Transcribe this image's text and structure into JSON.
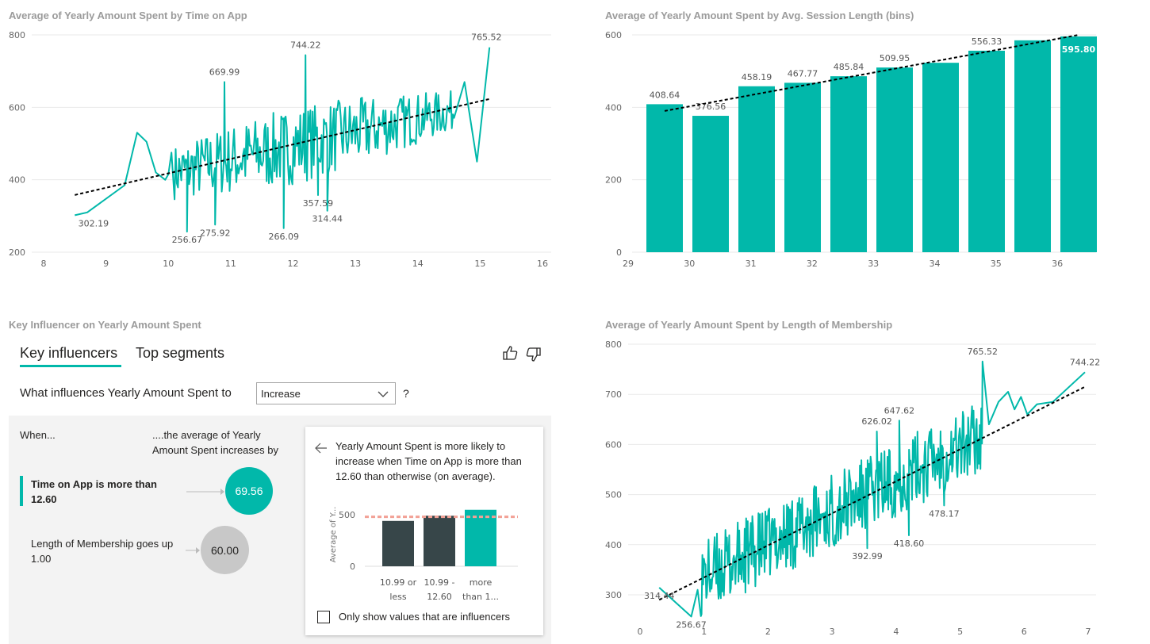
{
  "colors": {
    "teal": "#01b8aa",
    "dark": "#374649",
    "trend": "#000000",
    "mean": "#f2a196",
    "gray_bubble": "#c8c8c8"
  },
  "chart_data": [
    {
      "type": "line",
      "title": "Average of Yearly Amount Spent by Time on App",
      "xlim": [
        8,
        16
      ],
      "ylim": [
        200,
        800
      ],
      "x_ticks": [
        "8",
        "9",
        "10",
        "11",
        "12",
        "13",
        "14",
        "15",
        "16"
      ],
      "y_ticks": [
        "200",
        "400",
        "600",
        "800"
      ],
      "trendline": true,
      "annotations": [
        {
          "x": 8.8,
          "y": 302.19,
          "label": "302.19"
        },
        {
          "x": 10.3,
          "y": 256.67,
          "label": "256.67"
        },
        {
          "x": 10.75,
          "y": 275.92,
          "label": "275.92"
        },
        {
          "x": 10.9,
          "y": 669.99,
          "label": "669.99"
        },
        {
          "x": 11.85,
          "y": 266.09,
          "label": "266.09"
        },
        {
          "x": 12.2,
          "y": 744.22,
          "label": "744.22"
        },
        {
          "x": 12.4,
          "y": 357.59,
          "label": "357.59"
        },
        {
          "x": 12.55,
          "y": 314.44,
          "label": "314.44"
        },
        {
          "x": 15.1,
          "y": 765.52,
          "label": "765.52"
        }
      ]
    },
    {
      "type": "bar",
      "title": "Average of Yearly Amount Spent by Avg. Session Length (bins)",
      "categories": [
        "29",
        "30",
        "31",
        "32",
        "33",
        "34",
        "35",
        "36"
      ],
      "values": [
        408.64,
        376.56,
        458.19,
        467.77,
        485.84,
        509.95,
        523,
        556.33,
        585,
        595.8
      ],
      "bar_x": [
        29,
        30,
        31,
        32,
        33,
        34,
        35,
        36,
        37,
        38
      ],
      "data_labels": [
        "408.64",
        "376.56",
        "458.19",
        "467.77",
        "485.84",
        "509.95",
        "",
        "556.33",
        "",
        "595.80"
      ],
      "ylim": [
        0,
        600
      ],
      "y_ticks": [
        "0",
        "200",
        "400",
        "600"
      ],
      "trendline": true
    },
    {
      "type": "line",
      "title": "Average of Yearly Amount Spent by Length of Membership",
      "xlim": [
        0,
        7
      ],
      "ylim": [
        250,
        800
      ],
      "x_ticks": [
        "0",
        "1",
        "2",
        "3",
        "4",
        "5",
        "6",
        "7"
      ],
      "y_ticks": [
        "300",
        "400",
        "500",
        "600",
        "700",
        "800"
      ],
      "trendline": true,
      "annotations": [
        {
          "x": 0.3,
          "y": 314.44,
          "label": "314.44"
        },
        {
          "x": 0.8,
          "y": 256.67,
          "label": "256.67"
        },
        {
          "x": 3.55,
          "y": 392.99,
          "label": "392.99"
        },
        {
          "x": 3.7,
          "y": 626.02,
          "label": "626.02"
        },
        {
          "x": 4.05,
          "y": 647.62,
          "label": "647.62"
        },
        {
          "x": 4.2,
          "y": 418.6,
          "label": "418.60"
        },
        {
          "x": 4.75,
          "y": 478.17,
          "label": "478.17"
        },
        {
          "x": 5.35,
          "y": 765.52,
          "label": "765.52"
        },
        {
          "x": 6.95,
          "y": 744.22,
          "label": "744.22"
        }
      ]
    }
  ],
  "key_influencer": {
    "title": "Key Influencer on Yearly Amount Spent",
    "tab_key": "Key influencers",
    "tab_top": "Top segments",
    "question": "What influences Yearly Amount Spent to",
    "dropdown_value": "Increase",
    "question_mark": "?",
    "col_when": "When...",
    "col_avg": "....the average of Yearly Amount Spent increases by",
    "influencers": [
      {
        "label": "Time on App is more than 12.60",
        "value": "69.56"
      },
      {
        "label": "Length of Membership goes up 1.00",
        "value": "60.00"
      }
    ],
    "detail": {
      "text": "Yearly Amount Spent is more likely to increase when Time on App is more than 12.60 than otherwise (on average).",
      "ylabel": "Average of Y...",
      "y_ticks": [
        "0",
        "500"
      ],
      "chart": {
        "type": "bar",
        "categories": [
          "10.99 or less",
          "10.99 - 12.60",
          "more than 1..."
        ],
        "values": [
          440,
          490,
          548
        ],
        "mean": 480
      },
      "checkbox_label": "Only show values that are influencers",
      "checkbox_checked": false
    }
  }
}
